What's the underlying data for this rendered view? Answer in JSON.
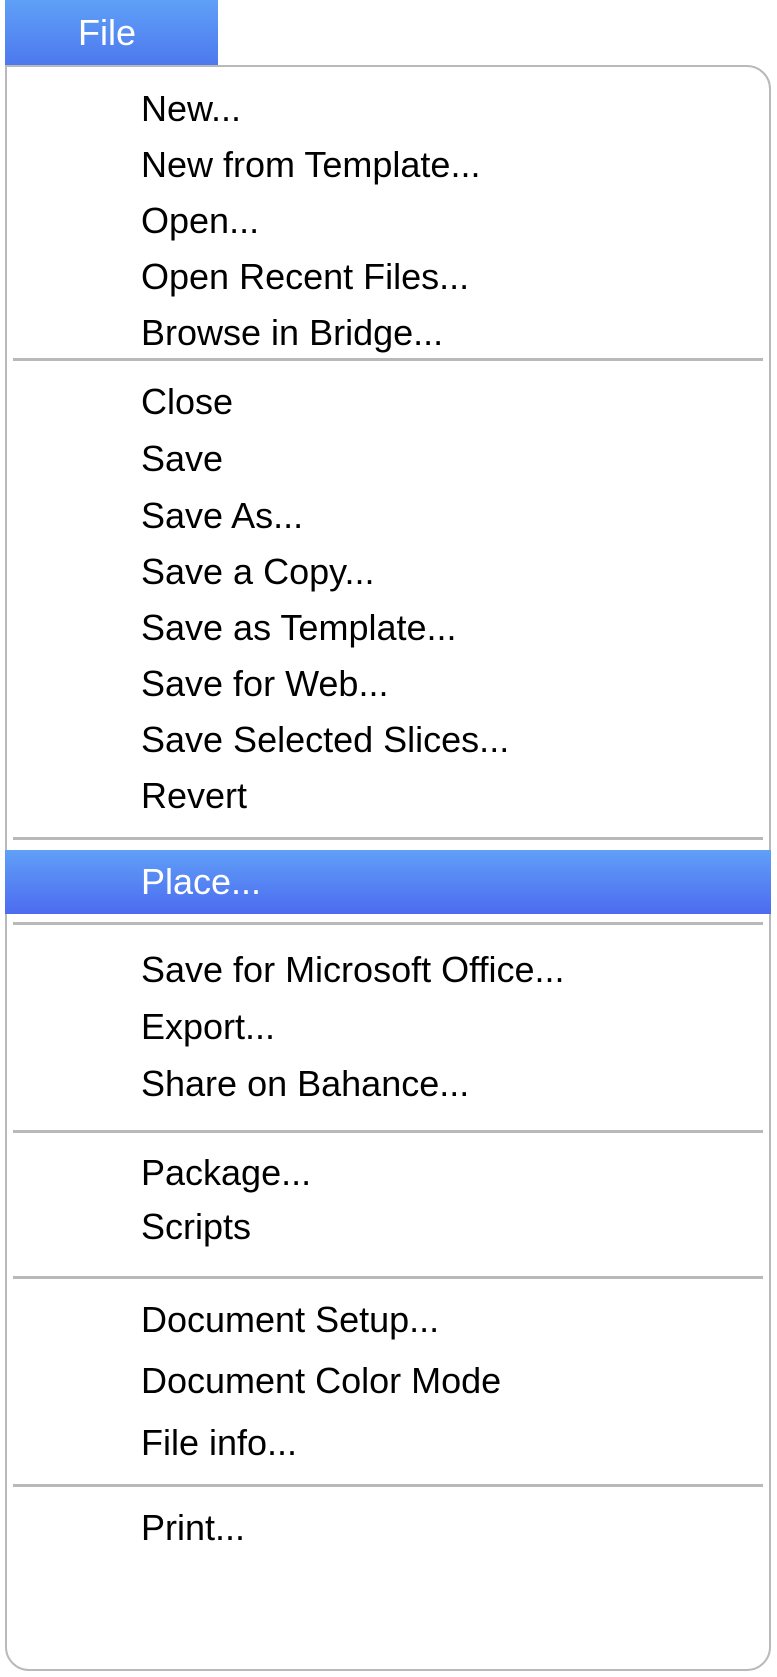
{
  "menu": {
    "title": "File",
    "highlight_color": "#4d78ee",
    "groups": [
      [
        "New...",
        "New from Template...",
        "Open...",
        "Open Recent Files...",
        "Browse in Bridge..."
      ],
      [
        "Close",
        "Save",
        "Save As...",
        "Save a Copy...",
        "Save as Template...",
        "Save for Web...",
        "Save Selected Slices...",
        "Revert"
      ],
      [
        "Place..."
      ],
      [
        "Save for Microsoft Office...",
        "Export...",
        "Share on Bahance..."
      ],
      [
        "Package...",
        "Scripts"
      ],
      [
        "Document Setup...",
        "Document Color Mode",
        "File info..."
      ],
      [
        "Print..."
      ]
    ],
    "highlighted_item": "Place..."
  }
}
